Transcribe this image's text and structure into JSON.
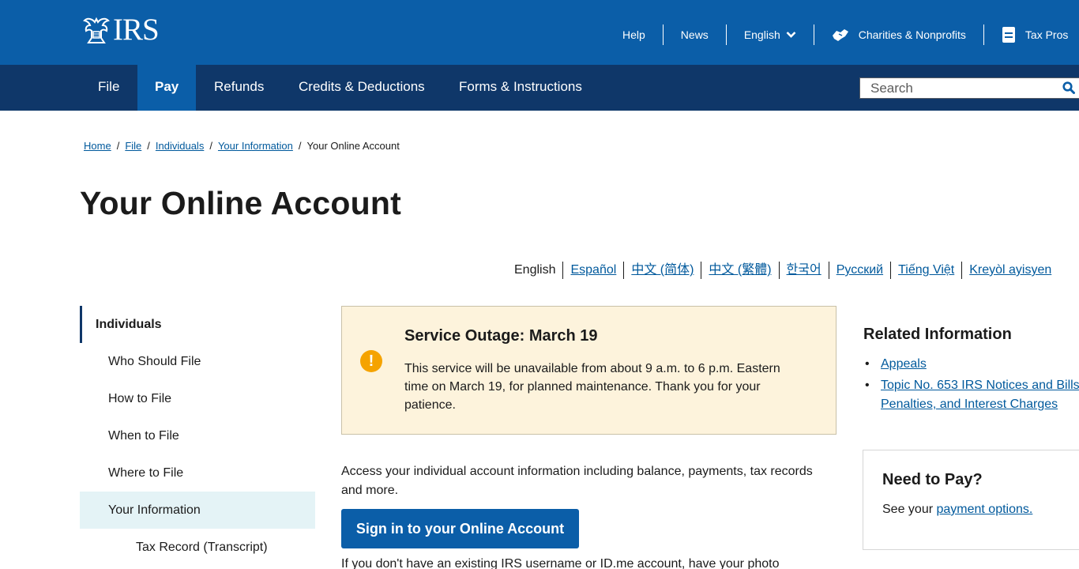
{
  "header": {
    "logo_text": "IRS",
    "util_links": [
      {
        "label": "Help"
      },
      {
        "label": "News"
      },
      {
        "label": "English"
      },
      {
        "label": "Charities & Nonprofits"
      },
      {
        "label": "Tax Pros"
      }
    ]
  },
  "nav": {
    "tabs": [
      {
        "label": "File"
      },
      {
        "label": "Pay"
      },
      {
        "label": "Refunds"
      },
      {
        "label": "Credits & Deductions"
      },
      {
        "label": "Forms & Instructions"
      }
    ],
    "active_tab": "Pay",
    "search_placeholder": "Search"
  },
  "breadcrumb": {
    "links": [
      "Home",
      "File",
      "Individuals",
      "Your Information"
    ],
    "current": "Your Online Account"
  },
  "page_title": "Your Online Account",
  "languages": {
    "current": "English",
    "links": [
      "Español",
      "中文 (简体)",
      "中文 (繁體)",
      "한국어",
      "Русский",
      "Tiếng Việt",
      "Kreyòl ayisyen"
    ]
  },
  "sidebar": {
    "heading": "Individuals",
    "items": [
      "Who Should File",
      "How to File",
      "When to File",
      "Where to File",
      "Your Information"
    ],
    "active_item": "Your Information",
    "sub_items": [
      "Tax Record (Transcript)"
    ]
  },
  "alert": {
    "title": "Service Outage: March 19",
    "body": "This service will be unavailable from about 9 a.m. to 6 p.m. Eastern time on March 19, for planned maintenance. Thank you for your patience.",
    "icon": "exclamation-icon",
    "color": "#f5a300"
  },
  "main": {
    "intro": "Access your individual account information including balance, payments, tax records and more.",
    "signin_label": "Sign in to your Online Account",
    "below_text": "If you don't have an existing IRS username or ID.me account, have your photo"
  },
  "related": {
    "heading": "Related Information",
    "links": [
      "Appeals",
      "Topic No. 653 IRS Notices and Bills, Penalties, and Interest Charges"
    ]
  },
  "pay_box": {
    "heading": "Need to Pay?",
    "text_prefix": "See your ",
    "link": "payment options."
  },
  "colors": {
    "header_blue": "#0b5ea8",
    "nav_navy": "#0f3769",
    "link_blue": "#00599c",
    "alert_bg": "#fdf3dc",
    "sidebar_active_bg": "#e4f3f6"
  }
}
